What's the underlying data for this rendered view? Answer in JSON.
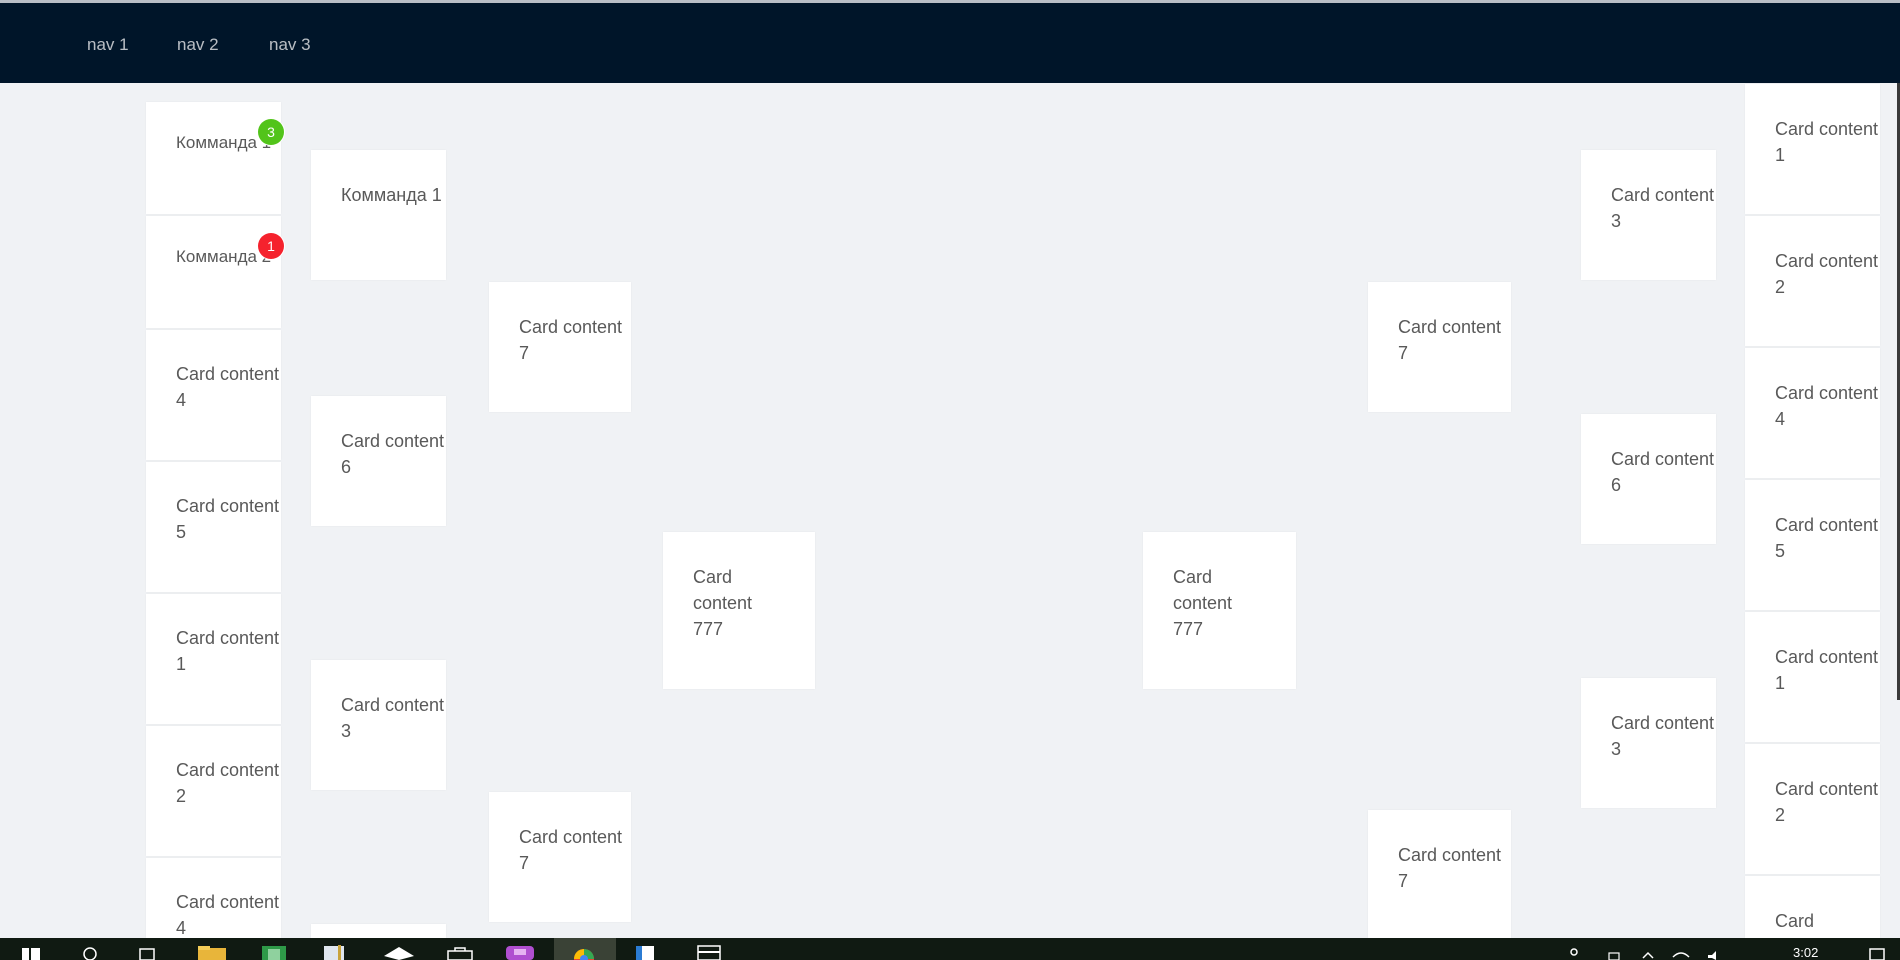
{
  "nav": [
    "nav 1",
    "nav 2",
    "nav 3"
  ],
  "colors": {
    "header_bg": "#001529",
    "page_bg": "#f0f2f5",
    "card_bg": "#ffffff",
    "badge_green": "#52c41a",
    "badge_red": "#f5222d"
  },
  "col1": [
    {
      "text": "Комманда 1",
      "badge": "3",
      "badge_color": "green"
    },
    {
      "text": "Комманда 2",
      "badge": "1",
      "badge_color": "red"
    },
    {
      "text": "Card content 4"
    },
    {
      "text": "Card content 5"
    },
    {
      "text": "Card content 1"
    },
    {
      "text": "Card content 2"
    },
    {
      "text": "Card content 4"
    }
  ],
  "col2": [
    "Комманда 1",
    "Card content 6",
    "Card content 3"
  ],
  "col3": [
    "Card content 7",
    "Card content 7"
  ],
  "col4": [
    "Card content 777"
  ],
  "col5": [
    "Card content 777"
  ],
  "col6": [
    "Card content 7",
    "Card content 7"
  ],
  "col7": [
    "Card content 3",
    "Card content 6",
    "Card content 3"
  ],
  "col8": [
    "Card content 1",
    "Card content 2",
    "Card content 4",
    "Card content 5",
    "Card content 1",
    "Card content 2",
    "Card"
  ],
  "taskbar": {
    "icons": [
      "start-icon",
      "search-icon",
      "task-view-icon",
      "file-explorer-icon",
      "spreadsheet-icon",
      "notepad-icon",
      "network-icon",
      "store-icon",
      "app-icon",
      "browser-icon",
      "document-icon",
      "calculator-icon"
    ],
    "clock": "3:02"
  }
}
